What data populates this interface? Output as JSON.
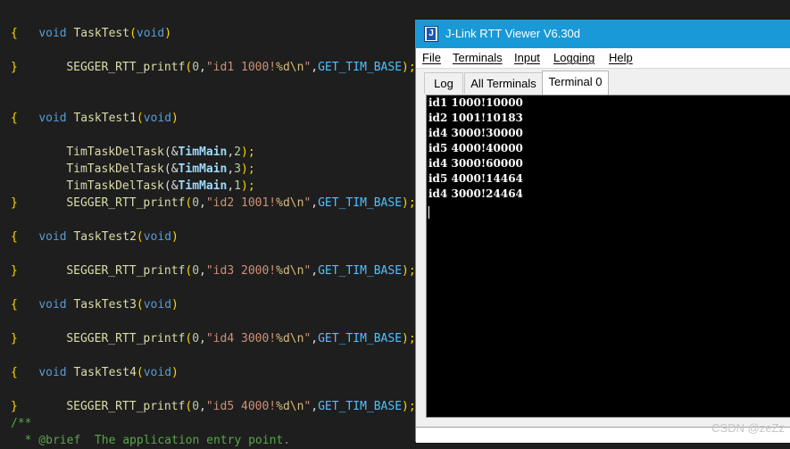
{
  "editor": {
    "lines": [
      {
        "kw": "void",
        "name": "TaskTest",
        "paren_open": "(",
        "param": "void",
        "paren_close": ")"
      },
      {
        "brace": "{"
      },
      {
        "call": "SEGGER_RTT_printf",
        "args_open": "(",
        "zero": "0",
        ",": ",",
        "str_a": "\"id1 1000!",
        "fmt": "%d",
        "esc": "\\n",
        "str_b": "\"",
        "comma2": ",",
        "macro": "GET_TIM_BASE",
        "end": ");"
      },
      {
        "brace": "}"
      },
      {
        "kw": "void",
        "name": "TaskTest1",
        "paren_open": "(",
        "param": "void",
        "paren_close": ")"
      },
      {
        "brace": "{"
      },
      {
        "call": "TimTaskDelTask",
        "pre": "(&",
        "var": "TimMain",
        "post": ",",
        "num": "2",
        "end": ");"
      },
      {
        "call": "TimTaskDelTask",
        "pre": "(&",
        "var": "TimMain",
        "post": ",",
        "num": "3",
        "end": ");"
      },
      {
        "call": "TimTaskDelTask",
        "pre": "(&",
        "var": "TimMain",
        "post": ",",
        "num": "1",
        "end": ");"
      },
      {
        "call": "SEGGER_RTT_printf",
        "args_open": "(",
        "zero": "0",
        ",": ",",
        "str_a": "\"id2 1001!",
        "fmt": "%d",
        "esc": "\\n",
        "str_b": "\"",
        "comma2": ",",
        "macro": "GET_TIM_BASE",
        "end": ");"
      },
      {
        "brace": "}"
      },
      {
        "kw": "void",
        "name": "TaskTest2",
        "paren_open": "(",
        "param": "void",
        "paren_close": ")"
      },
      {
        "brace": "{"
      },
      {
        "call": "SEGGER_RTT_printf",
        "args_open": "(",
        "zero": "0",
        ",": ",",
        "str_a": "\"id3 2000!",
        "fmt": "%d",
        "esc": "\\n",
        "str_b": "\"",
        "comma2": ",",
        "macro": "GET_TIM_BASE",
        "end": ");"
      },
      {
        "brace": "}"
      },
      {
        "kw": "void",
        "name": "TaskTest3",
        "paren_open": "(",
        "param": "void",
        "paren_close": ")"
      },
      {
        "brace": "{"
      },
      {
        "call": "SEGGER_RTT_printf",
        "args_open": "(",
        "zero": "0",
        ",": ",",
        "str_a": "\"id4 3000!",
        "fmt": "%d",
        "esc": "\\n",
        "str_b": "\"",
        "comma2": ",",
        "macro": "GET_TIM_BASE",
        "end": ");"
      },
      {
        "brace": "}"
      },
      {
        "kw": "void",
        "name": "TaskTest4",
        "paren_open": "(",
        "param": "void",
        "paren_close": ")"
      },
      {
        "brace": "{"
      },
      {
        "call": "SEGGER_RTT_printf",
        "args_open": "(",
        "zero": "0",
        ",": ",",
        "str_a": "\"id5 4000!",
        "fmt": "%d",
        "esc": "\\n",
        "str_b": "\"",
        "comma2": ",",
        "macro": "GET_TIM_BASE",
        "end": ");"
      },
      {
        "brace": "}"
      },
      {
        "comment": "/**"
      },
      {
        "comment": "  * @brief  The application entry point."
      }
    ]
  },
  "rtt_viewer": {
    "title": "J-Link RTT Viewer V6.30d",
    "icon_letter": "J",
    "menu": [
      "File",
      "Terminals",
      "Input",
      "Logging",
      "Help"
    ],
    "tabs": [
      "Log",
      "All Terminals",
      "Terminal 0"
    ],
    "active_tab": "Terminal 0",
    "terminal_lines": [
      "id1 1000!10000",
      "id2 1001!10183",
      "id4 3000!30000",
      "id5 4000!40000",
      "id4 3000!60000",
      "id5 4000!14464",
      "id4 3000!24464"
    ],
    "input_value": ""
  },
  "watermark": "CSDN @zeZz",
  "colors": {
    "editor_bg": "#1e1e1e",
    "titlebar": "#1999d6",
    "terminal_bg": "#000000"
  }
}
